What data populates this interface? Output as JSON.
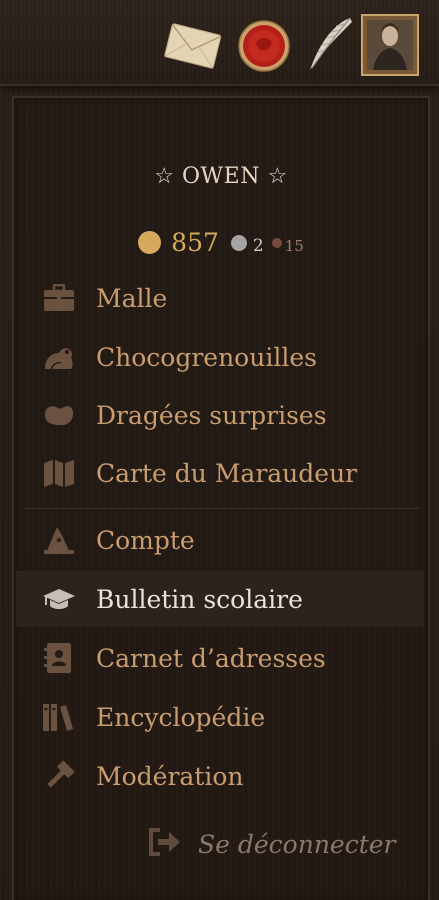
{
  "header": {
    "icons": [
      "envelope-icon",
      "wax-seal-icon",
      "quill-icon",
      "avatar-portrait"
    ]
  },
  "user": {
    "name": "☆ OWEN ☆",
    "currency": {
      "gold": "857",
      "silver": "2",
      "bronze": "15"
    }
  },
  "menu": {
    "items": [
      {
        "label": "Malle",
        "icon": "trunk-icon"
      },
      {
        "label": "Chocogrenouilles",
        "icon": "frog-icon"
      },
      {
        "label": "Dragées surprises",
        "icon": "bean-icon"
      },
      {
        "label": "Carte du Maraudeur",
        "icon": "map-icon"
      },
      {
        "label": "Compte",
        "icon": "wizard-hat-icon"
      },
      {
        "label": "Bulletin scolaire",
        "icon": "graduation-cap-icon"
      },
      {
        "label": "Carnet d’adresses",
        "icon": "address-book-icon"
      },
      {
        "label": "Encyclopédie",
        "icon": "books-icon"
      },
      {
        "label": "Modération",
        "icon": "gavel-icon"
      }
    ],
    "active_item": "Bulletin scolaire"
  },
  "logout": {
    "label": "Se déconnecter",
    "icon": "sign-out-icon"
  },
  "colors": {
    "background": "#241b15",
    "menu_text": "#c99d6f",
    "active_text": "#ece3d8",
    "icon": "#6b5140",
    "gold": "#d7a95c",
    "silver": "#a7a4a6",
    "bronze": "#7a4b3b",
    "logout_text": "#8c7868"
  }
}
